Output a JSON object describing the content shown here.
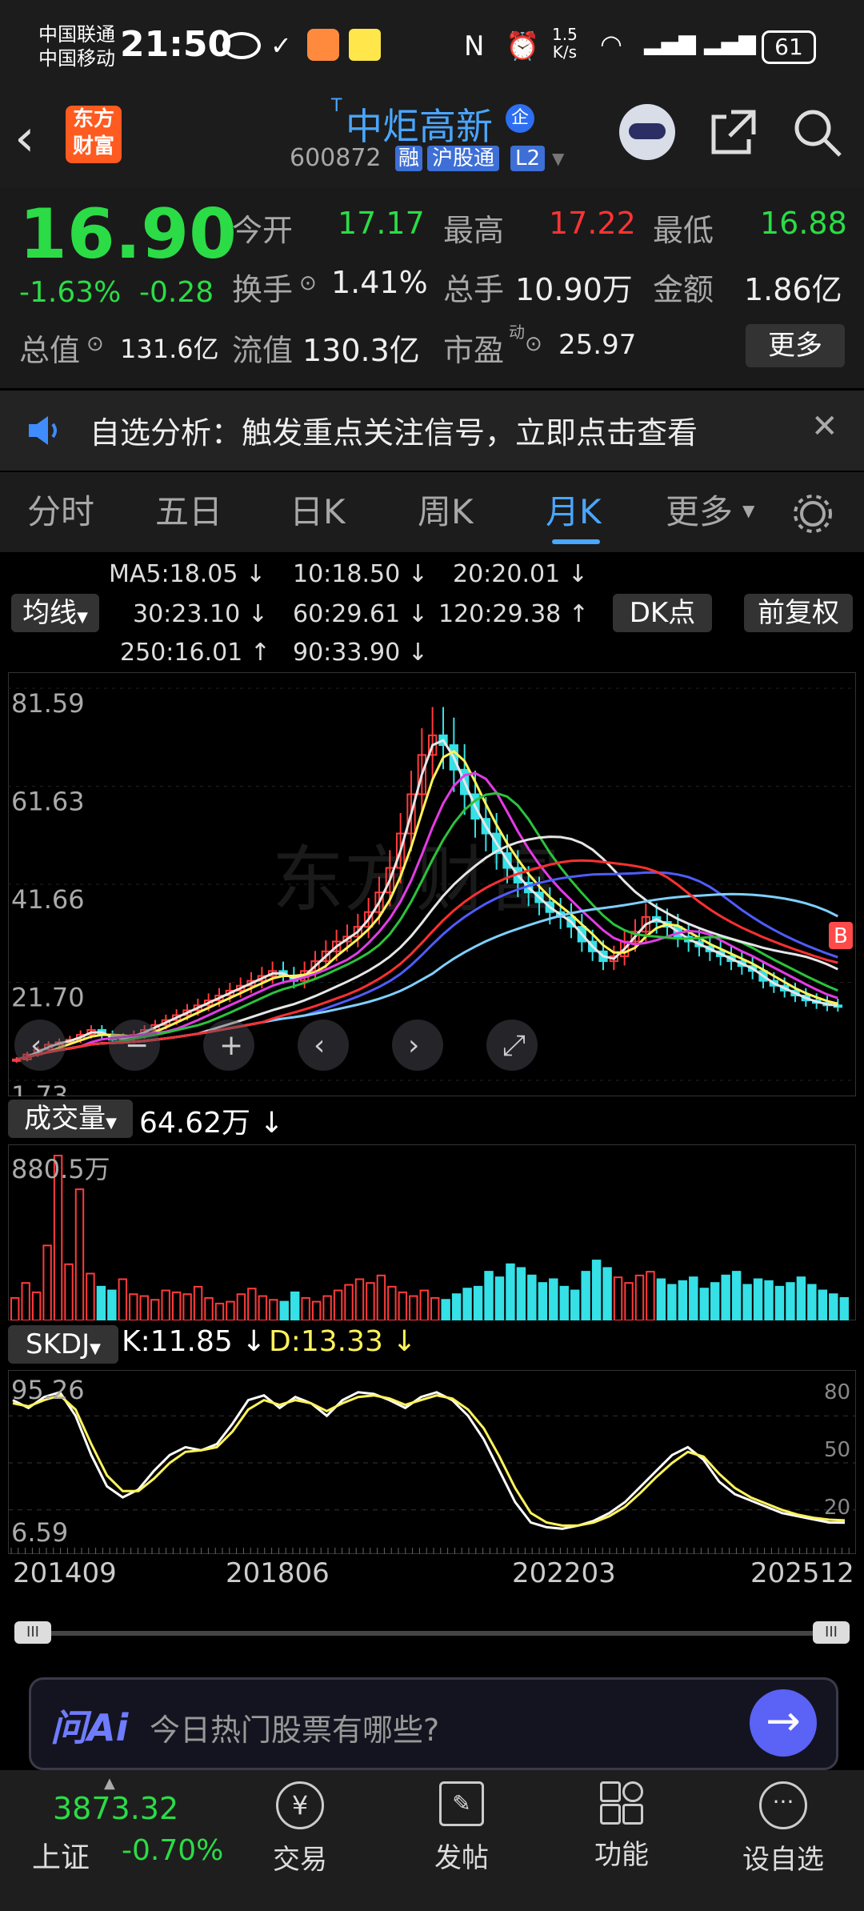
{
  "status_bar": {
    "carrier1": "中国联通",
    "carrier2": "中国移动",
    "time": "21:50",
    "net_speed": "1.5",
    "net_unit": "K/s",
    "battery": "61"
  },
  "header": {
    "logo_line1": "东方",
    "logo_line2": "财富",
    "stock_name": "中炬高新",
    "stock_code": "600872",
    "badge_rong": "融",
    "badge_hgt": "沪股通",
    "badge_l2": "L2",
    "t_mark": "T",
    "qi": "企"
  },
  "quote": {
    "price": "16.90",
    "change_pct": "-1.63%",
    "change": "-0.28",
    "open_label": "今开",
    "open": "17.17",
    "high_label": "最高",
    "high": "17.22",
    "low_label": "最低",
    "low": "16.88",
    "turnover_label": "换手",
    "turnover": "1.41%",
    "volume_label": "总手",
    "volume": "10.90万",
    "amount_label": "金额",
    "amount": "1.86亿",
    "mktcap_label": "总值",
    "mktcap": "131.6亿",
    "float_label": "流值",
    "float_cap": "130.3亿",
    "pe_label": "市盈",
    "pe_sup": "动",
    "pe": "25.97",
    "more": "更多"
  },
  "notice": {
    "text": "自选分析：触发重点关注信号，立即点击查看"
  },
  "tabs": [
    "分时",
    "五日",
    "日K",
    "周K",
    "月K",
    "更多"
  ],
  "active_tab": "月K",
  "chart_controls": {
    "ma_button": "均线",
    "dk_button": "DK点",
    "fq_button": "前复权",
    "ma_labels": [
      {
        "text": "MA5:18.05 ↓",
        "color": "#e6e6e6"
      },
      {
        "text": "10:18.50 ↓",
        "color": "#fff35a"
      },
      {
        "text": "20:20.01 ↓",
        "color": "#e23ce6"
      },
      {
        "text": "30:23.10 ↓",
        "color": "#2cc23c"
      },
      {
        "text": "60:29.61 ↓",
        "color": "#e6e6e6"
      },
      {
        "text": "120:29.38 ↑",
        "color": "#4f5cff"
      },
      {
        "text": "250:16.01 ↑",
        "color": "#7fd0ff"
      },
      {
        "text": "90:33.90 ↓",
        "color": "#ff3030"
      }
    ]
  },
  "chart_data": [
    {
      "type": "candlestick",
      "y_ticks": [
        "81.59",
        "61.63",
        "41.66",
        "21.70",
        "1.73"
      ],
      "ylim": [
        1.73,
        81.59
      ],
      "x_labels": [
        "201409",
        "201806",
        "202203",
        "202512"
      ],
      "watermark": "东方财富",
      "close": [
        6,
        7,
        8,
        9,
        9.5,
        10,
        11,
        12,
        11,
        10,
        10.5,
        11,
        12,
        13,
        14,
        15,
        16,
        17,
        18,
        19,
        20,
        21,
        22,
        23,
        24,
        23,
        22,
        24,
        26,
        28,
        30,
        31,
        33,
        36,
        40,
        45,
        52,
        60,
        68,
        72,
        70,
        65,
        60,
        55,
        52,
        48,
        45,
        42,
        40,
        38,
        36,
        35,
        33,
        30,
        28,
        26,
        27,
        30,
        32,
        35,
        34,
        33,
        31,
        30,
        29,
        28,
        27,
        26,
        25,
        24,
        22,
        21,
        20,
        19,
        18,
        17.5,
        17,
        16.9
      ],
      "ma_lines": [
        {
          "name": "MA5",
          "color": "#e6e6e6"
        },
        {
          "name": "10",
          "color": "#fff35a"
        },
        {
          "name": "20",
          "color": "#e23ce6"
        },
        {
          "name": "30",
          "color": "#2cc23c"
        },
        {
          "name": "60",
          "color": "#e6e6e6"
        },
        {
          "name": "120",
          "color": "#4f5cff"
        },
        {
          "name": "250",
          "color": "#7fd0ff"
        },
        {
          "name": "90",
          "color": "#ff3030"
        }
      ],
      "marker": "B"
    },
    {
      "type": "bar",
      "title": "成交量",
      "value_label": "64.62万 ↓",
      "y_top": "880.5万",
      "values": [
        120,
        200,
        150,
        400,
        880,
        300,
        700,
        250,
        180,
        160,
        220,
        140,
        130,
        110,
        160,
        150,
        140,
        180,
        120,
        90,
        100,
        140,
        170,
        130,
        110,
        100,
        150,
        120,
        100,
        130,
        160,
        190,
        220,
        200,
        240,
        180,
        150,
        130,
        160,
        120,
        110,
        140,
        170,
        180,
        260,
        230,
        300,
        280,
        240,
        200,
        220,
        180,
        160,
        260,
        320,
        280,
        230,
        200,
        240,
        260,
        220,
        190,
        210,
        230,
        170,
        200,
        240,
        260,
        190,
        220,
        210,
        180,
        200,
        230,
        190,
        160,
        140,
        120
      ]
    },
    {
      "type": "line",
      "title": "SKDJ",
      "k_label": "K:11.85 ↓",
      "d_label": "D:13.33 ↓",
      "y_ticks": [
        "95.26",
        "6.59"
      ],
      "right_ticks": [
        "80",
        "50",
        "20"
      ],
      "k": [
        90,
        85,
        92,
        95,
        80,
        55,
        35,
        28,
        33,
        45,
        55,
        60,
        58,
        62,
        75,
        90,
        93,
        85,
        92,
        88,
        80,
        90,
        95,
        94,
        90,
        85,
        92,
        95,
        90,
        80,
        65,
        45,
        25,
        12,
        9,
        8,
        10,
        13,
        18,
        25,
        35,
        45,
        55,
        60,
        52,
        38,
        30,
        26,
        22,
        18,
        16,
        14,
        12,
        11.85
      ],
      "d": [
        88,
        86,
        90,
        93,
        84,
        62,
        42,
        32,
        32,
        40,
        50,
        57,
        58,
        60,
        70,
        84,
        90,
        87,
        90,
        88,
        83,
        88,
        92,
        93,
        91,
        87,
        90,
        93,
        91,
        84,
        72,
        54,
        34,
        18,
        12,
        10,
        10,
        12,
        16,
        22,
        31,
        41,
        50,
        57,
        54,
        43,
        34,
        28,
        24,
        20,
        17,
        15,
        13.8,
        13.33
      ]
    }
  ],
  "scroll_bar": {
    "left_handle": "III",
    "right_handle": "III"
  },
  "ai_bar": {
    "logo": "问Ai",
    "placeholder": "今日热门股票有哪些?"
  },
  "bottom_nav": {
    "index_value": "3873.32",
    "index_name": "上证",
    "index_change": "-0.70%",
    "items": [
      "交易",
      "发帖",
      "功能",
      "设自选"
    ],
    "trade_glyph": "¥"
  }
}
